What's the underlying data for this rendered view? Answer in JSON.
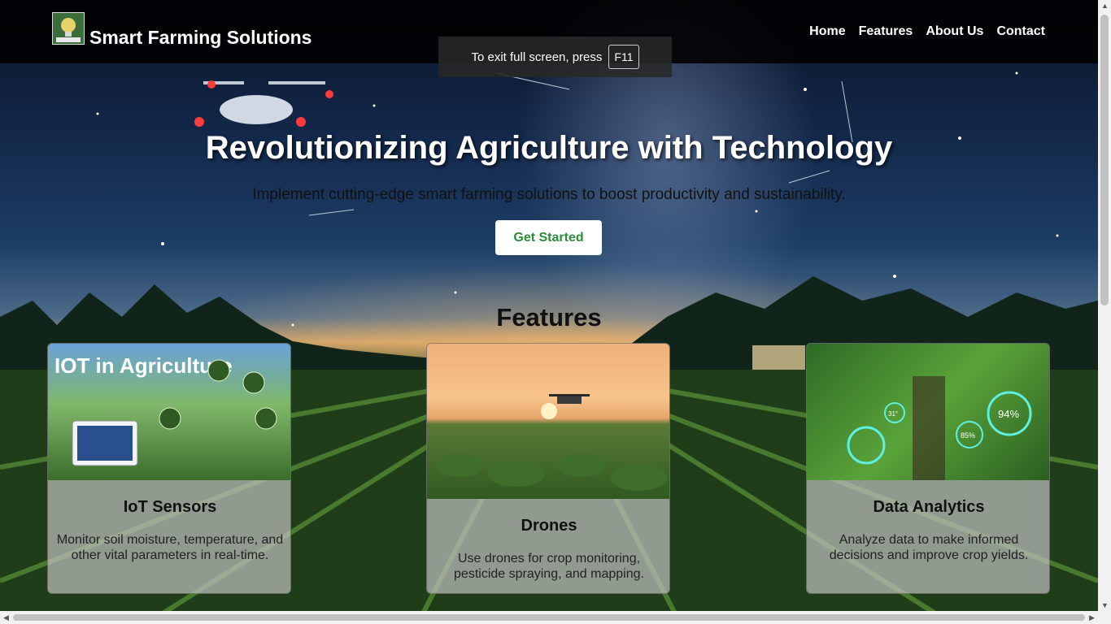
{
  "header": {
    "site_title": "Smart Farming Solutions",
    "nav": [
      "Home",
      "Features",
      "About Us",
      "Contact"
    ]
  },
  "toast": {
    "text": "To exit full screen, press",
    "key": "F11"
  },
  "hero": {
    "title": "Revolutionizing Agriculture with Technology",
    "subtitle": "Implement cutting-edge smart farming solutions to boost productivity and sustainability.",
    "cta": "Get Started"
  },
  "features": {
    "heading": "Features",
    "cards": [
      {
        "title": "IoT Sensors",
        "description": "Monitor soil moisture, temperature, and other vital parameters in real-time.",
        "image_text": "IOT in Agriculture"
      },
      {
        "title": "Drones",
        "description": "Use drones for crop monitoring, pesticide spraying, and mapping."
      },
      {
        "title": "Data Analytics",
        "description": "Analyze data to make informed decisions and improve crop yields.",
        "image_readouts": [
          "94%",
          "85%",
          "31°"
        ]
      }
    ]
  },
  "colors": {
    "cta_text": "#2e8b3a",
    "header_bg": "#000000"
  }
}
